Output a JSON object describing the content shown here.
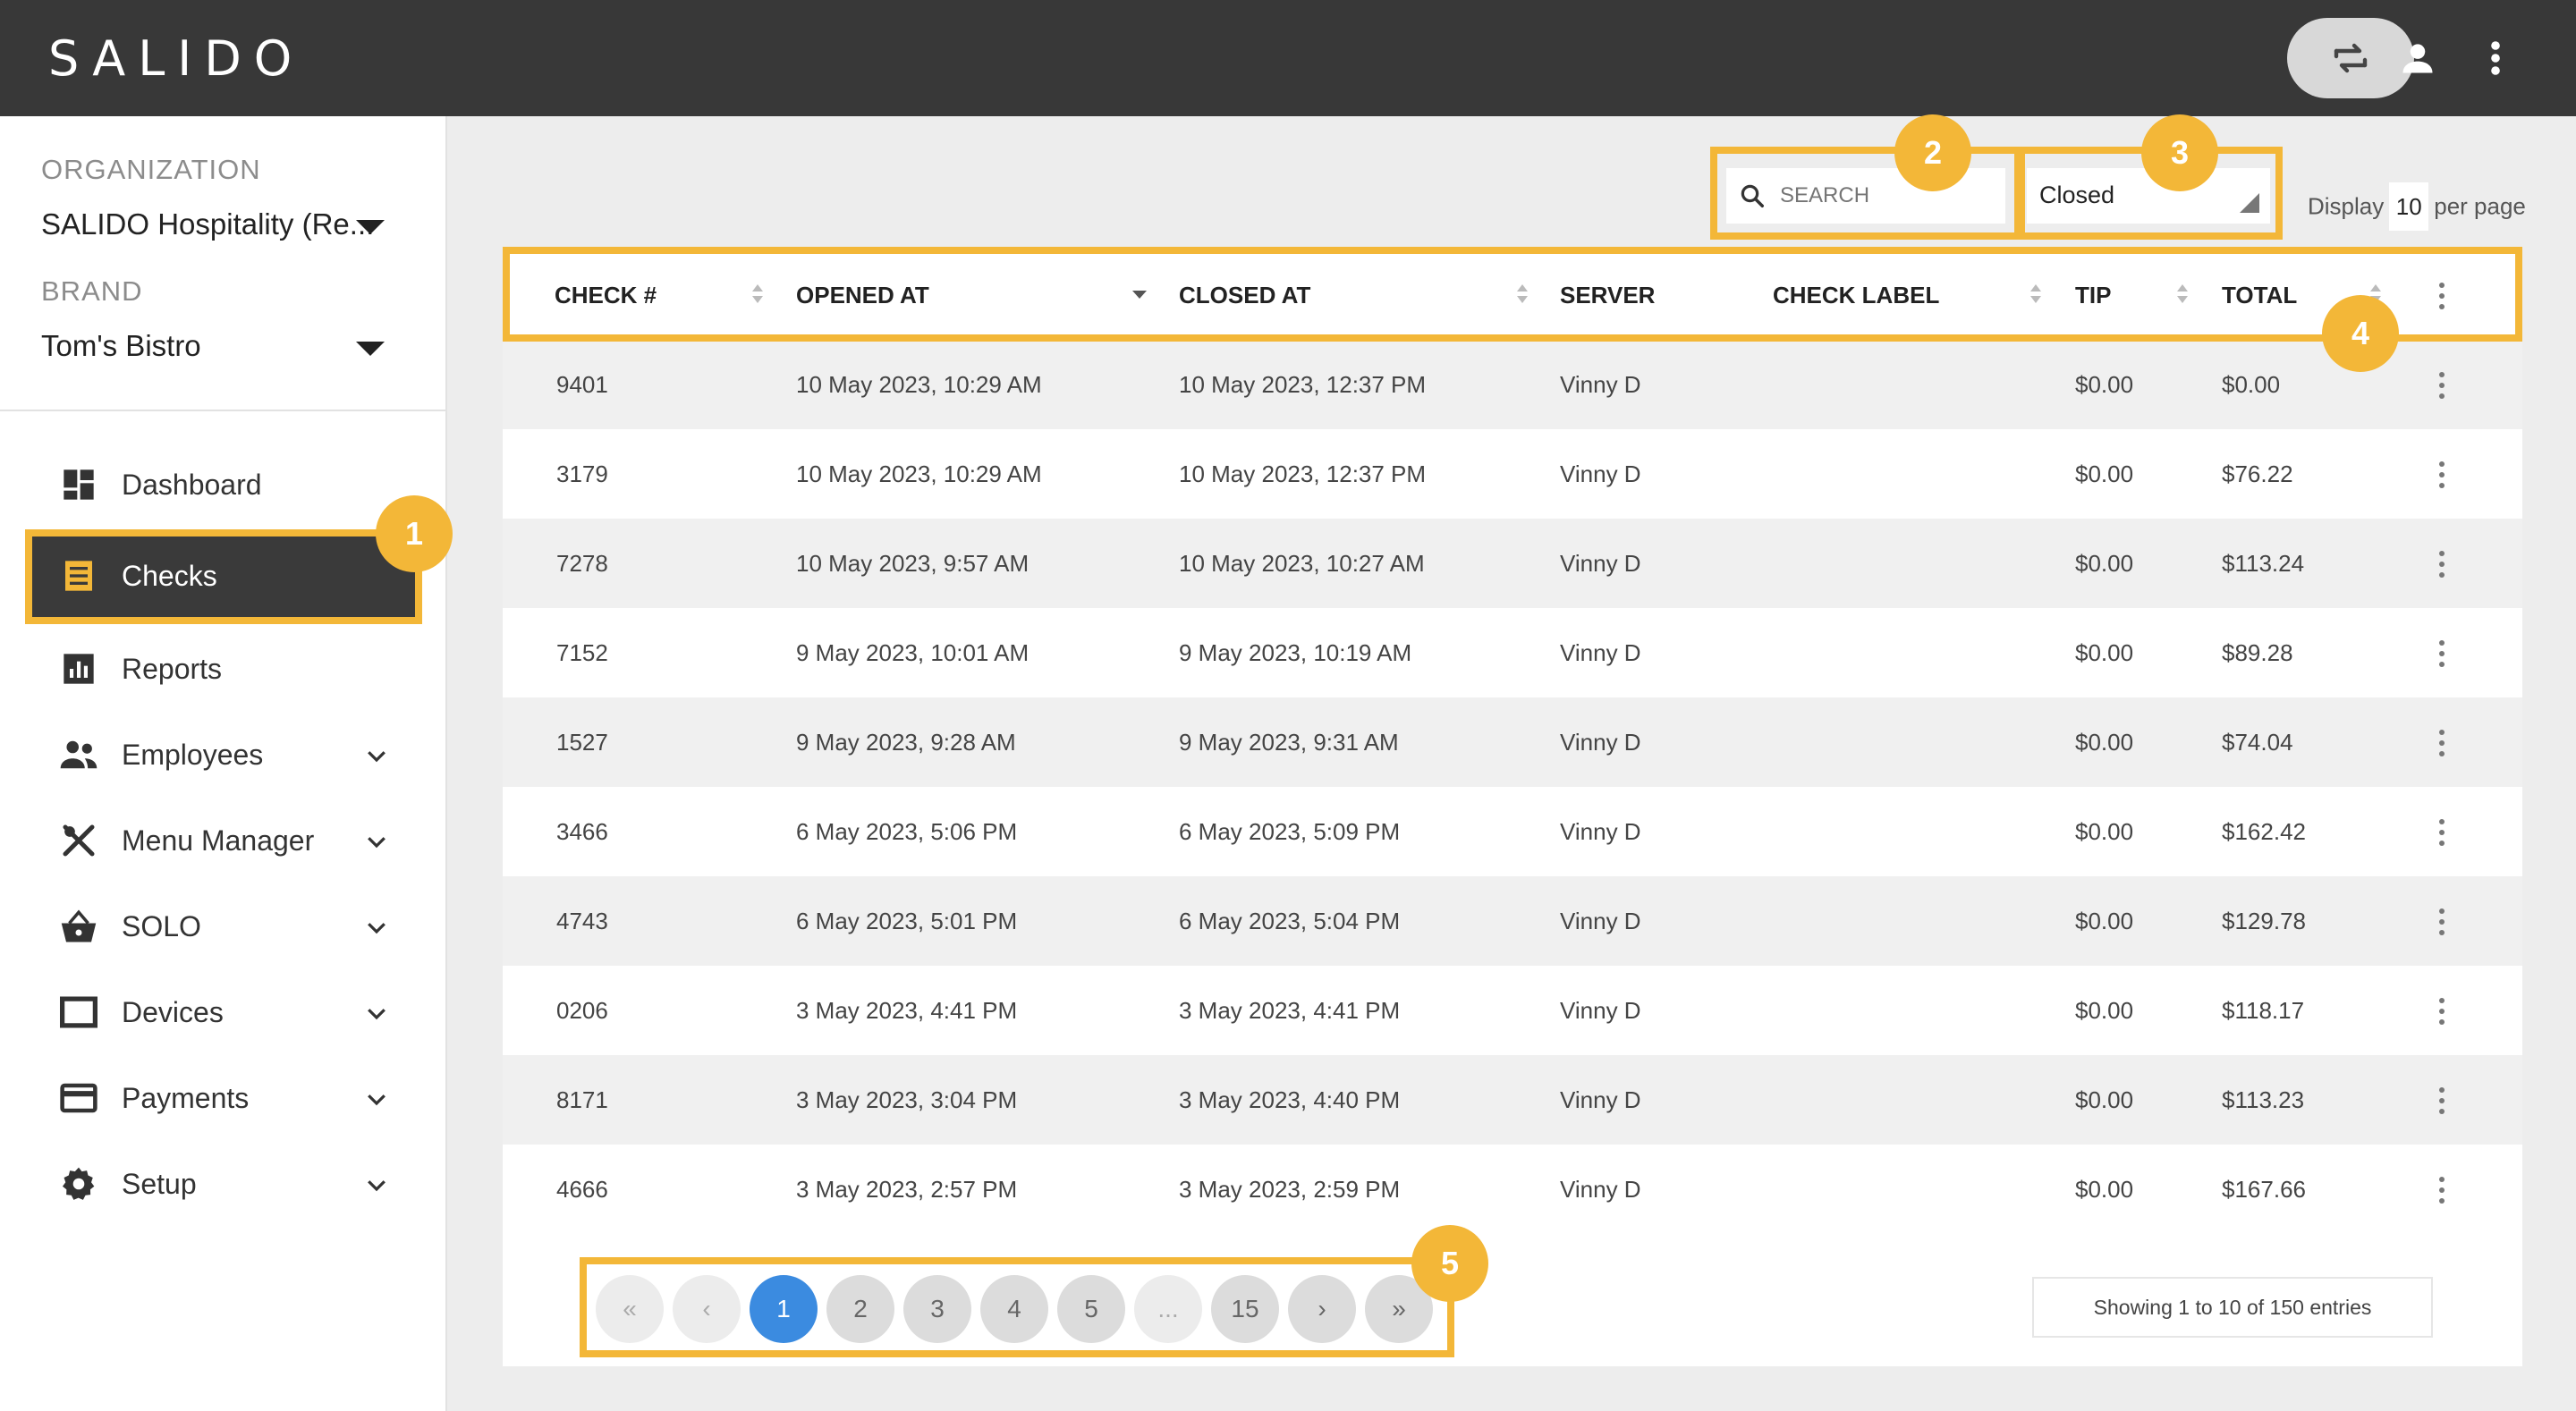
{
  "header": {
    "logo": "SALIDO",
    "icons": [
      "swap-icon",
      "user-icon",
      "more-vertical-icon"
    ]
  },
  "sidebar": {
    "organization_label": "ORGANIZATION",
    "organization_value": "SALIDO Hospitality (Re...",
    "brand_label": "BRAND",
    "brand_value": "Tom's Bistro",
    "items": [
      {
        "label": "Dashboard",
        "icon": "dashboard-icon"
      },
      {
        "label": "Checks",
        "icon": "receipt-icon"
      },
      {
        "label": "Reports",
        "icon": "bar-chart-icon"
      },
      {
        "label": "Employees",
        "icon": "people-icon"
      },
      {
        "label": "Menu Manager",
        "icon": "utensils-icon"
      },
      {
        "label": "SOLO",
        "icon": "basket-icon"
      },
      {
        "label": "Devices",
        "icon": "device-icon"
      },
      {
        "label": "Payments",
        "icon": "credit-card-icon"
      },
      {
        "label": "Setup",
        "icon": "gear-icon"
      }
    ]
  },
  "callouts": [
    "1",
    "2",
    "3",
    "4",
    "5"
  ],
  "toolbar": {
    "search_placeholder": "SEARCH",
    "status_value": "Closed",
    "display_label": "Display",
    "per_page_value": "10",
    "per_page_label": "per page"
  },
  "table": {
    "columns": [
      "CHECK #",
      "OPENED AT",
      "CLOSED AT",
      "SERVER",
      "CHECK LABEL",
      "TIP",
      "TOTAL"
    ],
    "rows": [
      [
        "9401",
        "10 May 2023, 10:29 AM",
        "10 May 2023, 12:37 PM",
        "Vinny D",
        "",
        "$0.00",
        "$0.00"
      ],
      [
        "3179",
        "10 May 2023, 10:29 AM",
        "10 May 2023, 12:37 PM",
        "Vinny D",
        "",
        "$0.00",
        "$76.22"
      ],
      [
        "7278",
        "10 May 2023, 9:57 AM",
        "10 May 2023, 10:27 AM",
        "Vinny D",
        "",
        "$0.00",
        "$113.24"
      ],
      [
        "7152",
        "9 May 2023, 10:01 AM",
        "9 May 2023, 10:19 AM",
        "Vinny D",
        "",
        "$0.00",
        "$89.28"
      ],
      [
        "1527",
        "9 May 2023, 9:28 AM",
        "9 May 2023, 9:31 AM",
        "Vinny D",
        "",
        "$0.00",
        "$74.04"
      ],
      [
        "3466",
        "6 May 2023, 5:06 PM",
        "6 May 2023, 5:09 PM",
        "Vinny D",
        "",
        "$0.00",
        "$162.42"
      ],
      [
        "4743",
        "6 May 2023, 5:01 PM",
        "6 May 2023, 5:04 PM",
        "Vinny D",
        "",
        "$0.00",
        "$129.78"
      ],
      [
        "0206",
        "3 May 2023, 4:41 PM",
        "3 May 2023, 4:41 PM",
        "Vinny D",
        "",
        "$0.00",
        "$118.17"
      ],
      [
        "8171",
        "3 May 2023, 3:04 PM",
        "3 May 2023, 4:40 PM",
        "Vinny D",
        "",
        "$0.00",
        "$113.23"
      ],
      [
        "4666",
        "3 May 2023, 2:57 PM",
        "3 May 2023, 2:59 PM",
        "Vinny D",
        "",
        "$0.00",
        "$167.66"
      ]
    ]
  },
  "pagination": {
    "first": "«",
    "prev": "‹",
    "pages": [
      "1",
      "2",
      "3",
      "4",
      "5",
      "...",
      "15"
    ],
    "next": "›",
    "last": "»",
    "current": "1",
    "entries_text": "Showing 1 to 10 of 150 entries"
  },
  "colors": {
    "topbar": "#383838",
    "accent": "#f3b738",
    "active_page": "#3b8be0",
    "active_nav": "#3a3a3a"
  }
}
